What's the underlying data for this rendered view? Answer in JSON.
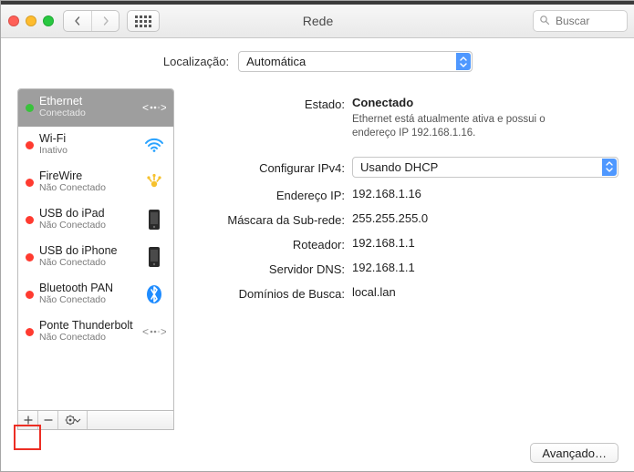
{
  "window": {
    "title": "Rede",
    "search_placeholder": "Buscar"
  },
  "location": {
    "label": "Localização:",
    "value": "Automática"
  },
  "sidebar": {
    "items": [
      {
        "name": "Ethernet",
        "status": "Conectado",
        "state": "green",
        "icon": "ethernet-icon",
        "selected": true
      },
      {
        "name": "Wi-Fi",
        "status": "Inativo",
        "state": "red",
        "icon": "wifi-icon"
      },
      {
        "name": "FireWire",
        "status": "Não Conectado",
        "state": "red",
        "icon": "firewire-icon"
      },
      {
        "name": "USB do iPad",
        "status": "Não Conectado",
        "state": "red",
        "icon": "device-icon"
      },
      {
        "name": "USB do iPhone",
        "status": "Não Conectado",
        "state": "red",
        "icon": "device-icon"
      },
      {
        "name": "Bluetooth PAN",
        "status": "Não Conectado",
        "state": "red",
        "icon": "bluetooth-icon"
      },
      {
        "name": "Ponte Thunderbolt",
        "status": "Não Conectado",
        "state": "red",
        "icon": "ethernet-icon"
      }
    ]
  },
  "detail": {
    "status_label": "Estado:",
    "status_value": "Conectado",
    "status_description": "Ethernet está atualmente ativa e possui o endereço IP 192.168.1.16.",
    "configure_label": "Configurar IPv4:",
    "configure_value": "Usando DHCP",
    "ip_label": "Endereço IP:",
    "ip_value": "192.168.1.16",
    "subnet_label": "Máscara da Sub-rede:",
    "subnet_value": "255.255.255.0",
    "router_label": "Roteador:",
    "router_value": "192.168.1.1",
    "dns_label": "Servidor DNS:",
    "dns_value": "192.168.1.1",
    "search_domains_label": "Domínios de Busca:",
    "search_domains_value": "local.lan",
    "advanced_button": "Avançado…"
  },
  "icons": {
    "plus": "+",
    "minus": "−",
    "gear": "✻",
    "chevron_min": "▾"
  }
}
